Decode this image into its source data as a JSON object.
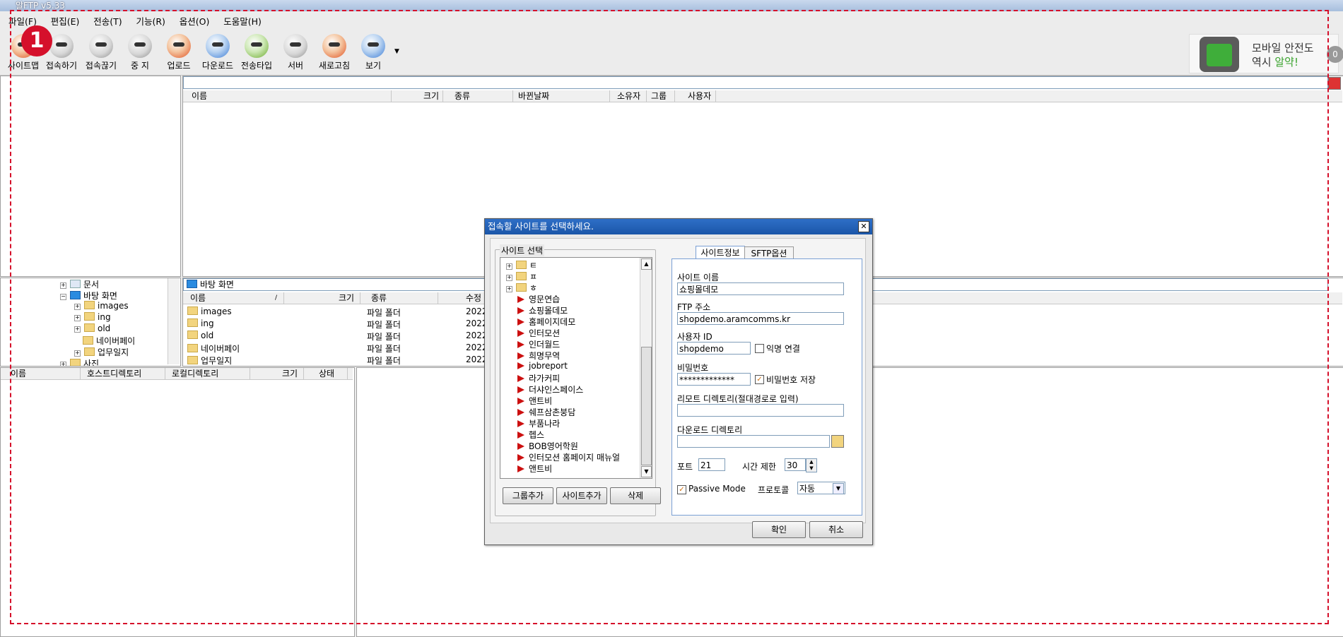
{
  "window": {
    "title": "알FTP  v5.33"
  },
  "menu": [
    "파일(F)",
    "편집(E)",
    "전송(T)",
    "기능(R)",
    "옵션(O)",
    "도움말(H)"
  ],
  "toolbar": [
    {
      "label": "사이트맵",
      "icon": "sitemap-icon"
    },
    {
      "label": "접속하기",
      "icon": "connect-icon"
    },
    {
      "label": "접속끊기",
      "icon": "disconnect-icon"
    },
    {
      "label": "중 지",
      "icon": "stop-icon"
    },
    {
      "label": "업로드",
      "icon": "upload-icon"
    },
    {
      "label": "다운로드",
      "icon": "download-icon"
    },
    {
      "label": "전송타입",
      "icon": "transfer-type-icon"
    },
    {
      "label": "서버",
      "icon": "server-icon"
    },
    {
      "label": "새로고침",
      "icon": "refresh-icon"
    },
    {
      "label": "보기",
      "icon": "view-icon"
    }
  ],
  "step_badge": "1",
  "ad": {
    "line1": "모바일 안전도",
    "line2_prefix": "역시 ",
    "line2_brand": "알약!",
    "count": "0"
  },
  "remote": {
    "columns": [
      "이름",
      "크기",
      "종류",
      "바뀐날짜",
      "소유자",
      "그룹",
      "사용자"
    ]
  },
  "local": {
    "path": "바탕 화면",
    "columns": [
      "이름",
      "크기",
      "종류",
      "수정"
    ],
    "files": [
      {
        "name": "images",
        "type": "파일 폴더",
        "date": "2022-"
      },
      {
        "name": "ing",
        "type": "파일 폴더",
        "date": "2022-"
      },
      {
        "name": "old",
        "type": "파일 폴더",
        "date": "2022-"
      },
      {
        "name": "네이버페이",
        "type": "파일 폴더",
        "date": "2022-"
      },
      {
        "name": "업무일지",
        "type": "파일 폴더",
        "date": "2022-"
      }
    ]
  },
  "tree": [
    "문서",
    "바탕 화면",
    "images",
    "ing",
    "old",
    "네이버페이",
    "업무일지",
    "사진"
  ],
  "queue": {
    "columns": [
      "이름",
      "호스트디렉토리",
      "로컬디렉토리",
      "크기",
      "상태"
    ]
  },
  "dialog": {
    "title": "접속할 사이트를 선택하세요.",
    "site_select_label": "사이트 선택",
    "groups": [
      "ㅌ",
      "ㅍ",
      "ㅎ"
    ],
    "sites": [
      "영문연습",
      "쇼핑몰데모",
      "홈페이지데모",
      "인터모션",
      "인더월드",
      "희명무역",
      "jobreport",
      "라가커피",
      "더샤인스페이스",
      "앤트비",
      "쉐프삼촌붕담",
      "부품나라",
      "헵스",
      "BOB영어학원",
      "인터모션 홈페이지 매뉴얼",
      "앤트비"
    ],
    "buttons": {
      "add_group": "그룹추가",
      "add_site": "사이트추가",
      "delete": "삭제",
      "ok": "확인",
      "cancel": "취소"
    },
    "tabs": [
      "사이트정보",
      "SFTP옵션"
    ],
    "fields": {
      "site_name_label": "사이트 이름",
      "site_name": "쇼핑몰데모",
      "ftp_label": "FTP 주소",
      "ftp": "shopdemo.aramcomms.kr",
      "user_label": "사용자 ID",
      "user": "shopdemo",
      "anon_label": "익명 연결",
      "pw_label": "비밀번호",
      "pw": "*************",
      "save_pw_label": "비밀번호 저장",
      "remote_dir_label": "리모트 디렉토리(절대경로로 입력)",
      "remote_dir": "",
      "download_dir_label": "다운로드 디렉토리",
      "download_dir": "",
      "port_label": "포트",
      "port": "21",
      "timeout_label": "시간 제한",
      "timeout": "30",
      "passive_label": "Passive Mode",
      "protocol_label": "프로토콜",
      "protocol": "자동"
    }
  }
}
